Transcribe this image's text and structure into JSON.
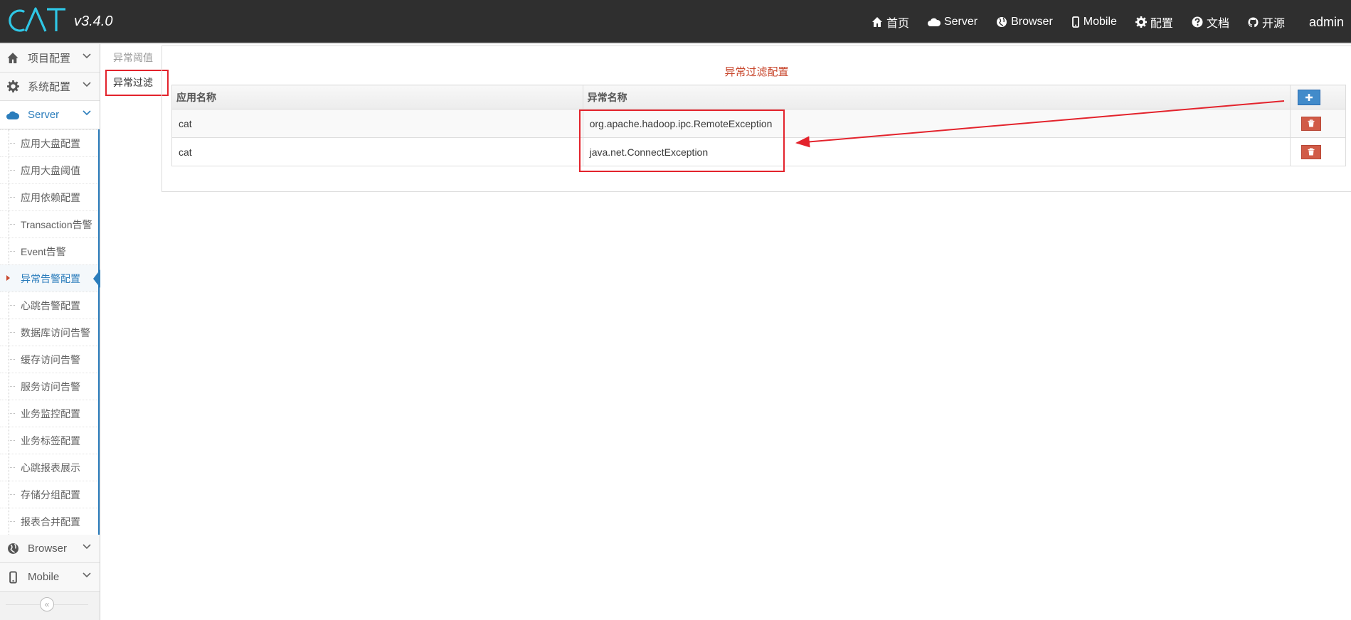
{
  "navbar": {
    "logo": "CAT",
    "version": "v3.4.0",
    "items": [
      {
        "label": "首页",
        "icon": "home-icon"
      },
      {
        "label": "Server",
        "icon": "cloud-icon"
      },
      {
        "label": "Browser",
        "icon": "globe-icon"
      },
      {
        "label": "Mobile",
        "icon": "mobile-icon"
      },
      {
        "label": "配置",
        "icon": "gear-icon"
      },
      {
        "label": "文档",
        "icon": "question-icon"
      },
      {
        "label": "开源",
        "icon": "github-icon"
      }
    ],
    "user": "admin"
  },
  "sidebar": {
    "sections": [
      {
        "label": "项目配置",
        "icon": "home-icon"
      },
      {
        "label": "系统配置",
        "icon": "gear-icon"
      },
      {
        "label": "Server",
        "icon": "cloud-icon"
      }
    ],
    "server_items": [
      "应用大盘配置",
      "应用大盘阈值",
      "应用依赖配置",
      "Transaction告警",
      "Event告警",
      "异常告警配置",
      "心跳告警配置",
      "数据库访问告警",
      "缓存访问告警",
      "服务访问告警",
      "业务监控配置",
      "业务标签配置",
      "心跳报表展示",
      "存储分组配置",
      "报表合并配置"
    ],
    "active_item": "异常告警配置",
    "bottom_sections": [
      {
        "label": "Browser",
        "icon": "globe-icon"
      },
      {
        "label": "Mobile",
        "icon": "mobile-icon"
      }
    ],
    "collapse_symbol": "«"
  },
  "tabs": [
    "异常阈值",
    "异常过滤"
  ],
  "active_tab": "异常过滤",
  "panel": {
    "title": "异常过滤配置",
    "columns": [
      "应用名称",
      "异常名称",
      ""
    ],
    "rows": [
      {
        "app": "cat",
        "exception": "org.apache.hadoop.ipc.RemoteException"
      },
      {
        "app": "cat",
        "exception": "java.net.ConnectException"
      }
    ]
  },
  "colors": {
    "navbar_bg": "#2f2f2f",
    "accent_blue": "#2b7dbc",
    "title_red": "#c8472d",
    "add_button": "#428bca",
    "delete_button": "#d15b47",
    "annotation_red": "#e3232c"
  }
}
